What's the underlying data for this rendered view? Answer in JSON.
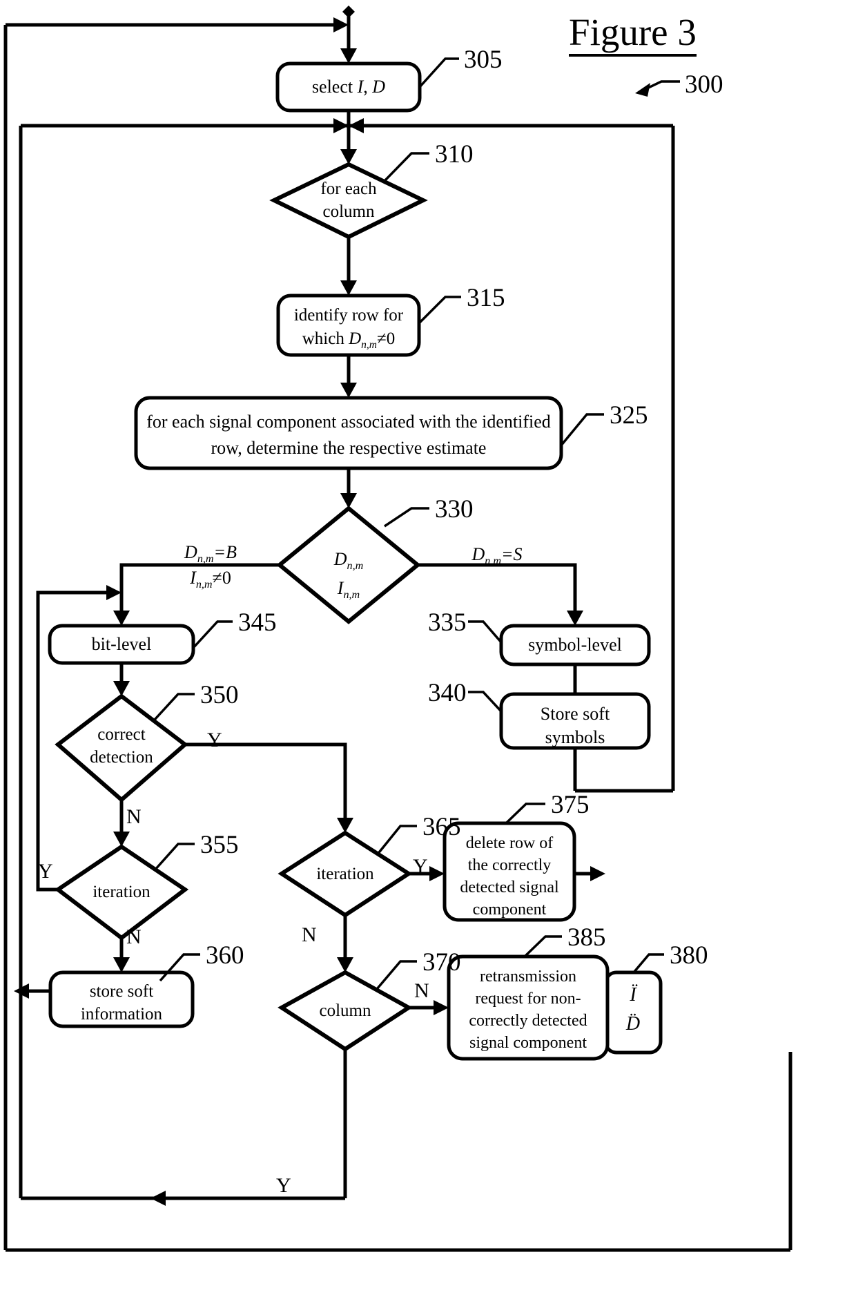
{
  "figure": {
    "title": "Figure 3",
    "diagram_ref": "300"
  },
  "nodes": {
    "n305": {
      "ref": "305",
      "label": "select I, D",
      "shape": "process"
    },
    "n310": {
      "ref": "310",
      "label_line1": "for each",
      "label_line2": "column",
      "shape": "decision"
    },
    "n315": {
      "ref": "315",
      "label_line1": "identify row for",
      "label_line2": "which Dn,m≠0",
      "shape": "process"
    },
    "n325": {
      "ref": "325",
      "label_line1": "for each signal component associated with the identified",
      "label_line2": "row, determine the respective estimate",
      "shape": "process"
    },
    "n330": {
      "ref": "330",
      "label_line1": "Dn,m",
      "label_line2": "In,m",
      "shape": "decision"
    },
    "n335": {
      "ref": "335",
      "label": "symbol-level",
      "shape": "process"
    },
    "n340": {
      "ref": "340",
      "label_line1": "Store soft",
      "label_line2": "symbols",
      "shape": "process"
    },
    "n345": {
      "ref": "345",
      "label": "bit-level",
      "shape": "process"
    },
    "n350": {
      "ref": "350",
      "label_line1": "correct",
      "label_line2": "detection",
      "shape": "decision"
    },
    "n355": {
      "ref": "355",
      "label": "iteration",
      "shape": "decision"
    },
    "n360": {
      "ref": "360",
      "label_line1": "store soft",
      "label_line2": "information",
      "shape": "process"
    },
    "n365": {
      "ref": "365",
      "label": "iteration",
      "shape": "decision"
    },
    "n370": {
      "ref": "370",
      "label": "column",
      "shape": "decision"
    },
    "n375": {
      "ref": "375",
      "label_line1": "delete row of",
      "label_line2": "the correctly",
      "label_line3": "detected signal",
      "label_line4": "component",
      "shape": "process"
    },
    "n380": {
      "ref": "380",
      "label_line1": "Ï",
      "label_line2": "D̈",
      "shape": "process"
    },
    "n385": {
      "ref": "385",
      "label_line1": "retransmission",
      "label_line2": "request for non-",
      "label_line3": "correctly detected",
      "label_line4": "signal component",
      "shape": "process"
    }
  },
  "branch_labels": {
    "left_top": "Dn,m=B",
    "left_bottom": "In,m≠0",
    "right": "Dn,m=S"
  },
  "edge_labels": {
    "correct_detection_yes": "Y",
    "correct_detection_no": "N",
    "iteration355_yes": "Y",
    "iteration355_no": "N",
    "iteration365_yes": "Y",
    "iteration365_no": "N",
    "column370_no": "N",
    "column370_yes": "Y"
  },
  "style": {
    "line_color": "#000000",
    "fill_color": "#ffffff"
  }
}
